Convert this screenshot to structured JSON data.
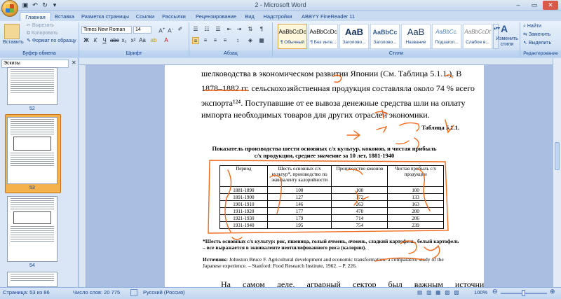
{
  "window": {
    "title": "2 - Microsoft Word"
  },
  "tabs": [
    {
      "label": "Главная",
      "active": true
    },
    {
      "label": "Вставка"
    },
    {
      "label": "Разметка страницы"
    },
    {
      "label": "Ссылки"
    },
    {
      "label": "Рассылки"
    },
    {
      "label": "Рецензирование"
    },
    {
      "label": "Вид"
    },
    {
      "label": "Надстройки"
    },
    {
      "label": "ABBYY FineReader 11"
    }
  ],
  "clipboard": {
    "paste": "Вставить",
    "cut": "Вырезать",
    "copy": "Копировать",
    "format_painter": "Формат по образцу",
    "label": "Буфер обмена"
  },
  "font": {
    "name": "Times New Roman",
    "size": "14",
    "label": "Шрифт"
  },
  "paragraph": {
    "label": "Абзац"
  },
  "styles": {
    "label": "Стили",
    "items": [
      {
        "preview": "AaBbCcDc",
        "name": "¶ Обычный"
      },
      {
        "preview": "AaBbCcDc",
        "name": "¶ Без инте..."
      },
      {
        "preview": "AaB",
        "name": "Заголово..."
      },
      {
        "preview": "AaBbCc",
        "name": "Заголово..."
      },
      {
        "preview": "AaB",
        "name": "Название"
      },
      {
        "preview": "AaBbCc.",
        "name": "Подзагол..."
      },
      {
        "preview": "AaBbCcDt",
        "name": "Слабое в..."
      }
    ],
    "change_styles": "Изменить стили"
  },
  "editing": {
    "label": "Редактирование",
    "find": "Найти",
    "replace": "Заменить",
    "select": "Выделить"
  },
  "left_pane": {
    "view": "Эскизы",
    "pages": [
      "52",
      "53",
      "54"
    ]
  },
  "document": {
    "para1_line1": "шелководства в экономическом развитии Японии (См. Таблица 5.1.1.). В",
    "para1_line2": "1878–1882 гг. сельскохозяйственная продукция составляла около 74 % всего",
    "para1_line3": "экспорта¹²⁴. Поступавшие от ее вывоза денежные средства шли на оплату",
    "para1_line4": "импорта необходимых товаров для других отраслей экономики.",
    "table_number": "Таблица 5.1.1.",
    "caption_line1": "Показатель производства шести основных с/х культур, коконов, и чистая прибыль",
    "caption_line2": "с/х продукции, среднее значение за 10 лет, 1881-1940",
    "note": "*Шесть основных с/х культур: рис, пшеница, голый ячмень, ячмень, сладкий картофель, белый картофель – все выражается в эквиваленте неотшлифованного риса (калории).",
    "source_label": "Источник:",
    "source_text": " Johnston Bruce F. Agricultural development and economic transformation: a comparative study of the Japanese experience. – Stanford: Food Research Institute, 1962. – P. 226.",
    "para2": "На самом деле, аграрный сектор был важным источником"
  },
  "table": {
    "headers": [
      "Период",
      "Шесть основных с/х культур*, производство по эквиваленту калорийности",
      "Производство коконов",
      "Чистая прибыль с/х продукции"
    ],
    "rows": [
      [
        "1881-1890",
        "100",
        "100",
        "100"
      ],
      [
        "1891-1900",
        "127",
        "172",
        "133"
      ],
      [
        "1901-1910",
        "146",
        "263",
        "163"
      ],
      [
        "1911-1920",
        "177",
        "470",
        "200"
      ],
      [
        "1921-1930",
        "179",
        "714",
        "206"
      ],
      [
        "1931-1940",
        "195",
        "754",
        "239"
      ]
    ]
  },
  "status": {
    "page": "Страница: 53 из 86",
    "words": "Число слов: 20 775",
    "language": "Русский (Россия)",
    "zoom": "100%"
  },
  "colors": {
    "accent": "#15428b",
    "ribbon": "#dbe7f6",
    "selection": "#f5b14c",
    "ink": "#f06a1c"
  }
}
